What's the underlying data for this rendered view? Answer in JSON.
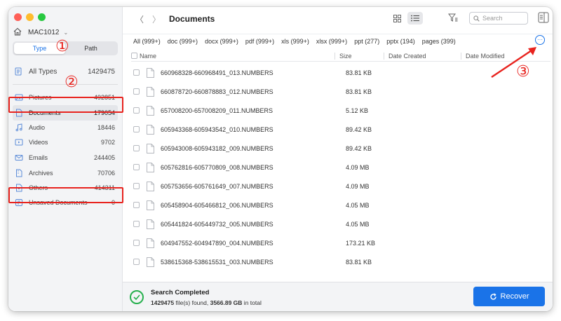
{
  "window": {
    "title": "Documents"
  },
  "device": {
    "name": "MAC1012"
  },
  "segment": {
    "type_label": "Type",
    "path_label": "Path"
  },
  "sidebar": {
    "items": [
      {
        "label": "All Types",
        "count": "1429475",
        "icon": "all-types-icon"
      },
      {
        "label": "Pictures",
        "count": "492851",
        "icon": "picture-icon"
      },
      {
        "label": "Documents",
        "count": "179054",
        "icon": "document-icon"
      },
      {
        "label": "Audio",
        "count": "18446",
        "icon": "audio-icon"
      },
      {
        "label": "Videos",
        "count": "9702",
        "icon": "video-icon"
      },
      {
        "label": "Emails",
        "count": "244405",
        "icon": "email-icon"
      },
      {
        "label": "Archives",
        "count": "70706",
        "icon": "archive-icon"
      },
      {
        "label": "Others",
        "count": "414311",
        "icon": "others-icon"
      },
      {
        "label": "Unsaved Documents",
        "count": "0",
        "icon": "unsaved-document-icon"
      }
    ]
  },
  "search": {
    "placeholder": "Search"
  },
  "filter_tabs": [
    "All (999+)",
    "doc (999+)",
    "docx (999+)",
    "pdf (999+)",
    "xls (999+)",
    "xlsx (999+)",
    "ppt (277)",
    "pptx (194)",
    "pages (399)"
  ],
  "table": {
    "headers": {
      "name": "Name",
      "size": "Size",
      "created": "Date Created",
      "modified": "Date Modified"
    },
    "rows": [
      {
        "name": "660968328-660968491_013.NUMBERS",
        "size": "83.81 KB"
      },
      {
        "name": "660878720-660878883_012.NUMBERS",
        "size": "83.81 KB"
      },
      {
        "name": "657008200-657008209_011.NUMBERS",
        "size": "5.12 KB"
      },
      {
        "name": "605943368-605943542_010.NUMBERS",
        "size": "89.42 KB"
      },
      {
        "name": "605943008-605943182_009.NUMBERS",
        "size": "89.42 KB"
      },
      {
        "name": "605762816-605770809_008.NUMBERS",
        "size": "4.09 MB"
      },
      {
        "name": "605753656-605761649_007.NUMBERS",
        "size": "4.09 MB"
      },
      {
        "name": "605458904-605466812_006.NUMBERS",
        "size": "4.05 MB"
      },
      {
        "name": "605441824-605449732_005.NUMBERS",
        "size": "4.05 MB"
      },
      {
        "name": "604947552-604947890_004.NUMBERS",
        "size": "173.21 KB"
      },
      {
        "name": "538615368-538615531_003.NUMBERS",
        "size": "83.81 KB"
      }
    ]
  },
  "footer": {
    "status_title": "Search Completed",
    "files_count": "1429475",
    "files_text": " file(s) found, ",
    "total_size": "3566.89 GB",
    "total_text": " in total",
    "recover_label": "Recover"
  },
  "annotations": {
    "one": "①",
    "two": "②",
    "three": "③"
  },
  "colors": {
    "accent": "#1a73e8",
    "highlight_box": "#e8231e",
    "success": "#27b04e"
  }
}
